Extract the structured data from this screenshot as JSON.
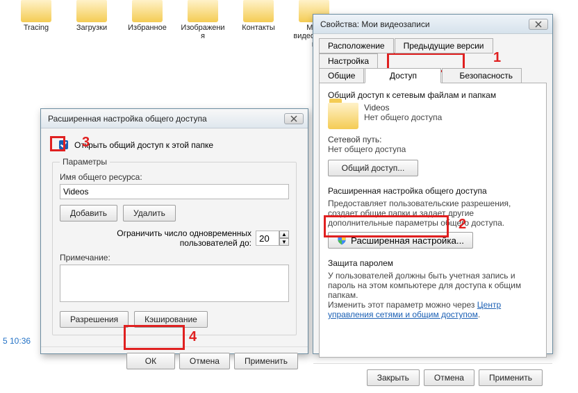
{
  "desktop": {
    "folders": [
      {
        "label": "Tracing"
      },
      {
        "label": "Загрузки"
      },
      {
        "label": "Избранное"
      },
      {
        "label": "Изображения"
      },
      {
        "label": "Контакты"
      },
      {
        "label": "Мои видеозаписи"
      }
    ],
    "timestamp": "5 10:36"
  },
  "adv": {
    "title": "Расширенная настройка общего доступа",
    "share_checkbox_label": "Открыть общий доступ к этой папке",
    "params_legend": "Параметры",
    "share_name_label": "Имя общего ресурса:",
    "share_name_value": "Videos",
    "add_btn": "Добавить",
    "remove_btn": "Удалить",
    "limit_label": "Ограничить число одновременных пользователей до:",
    "limit_value": "20",
    "note_label": "Примечание:",
    "perm_btn": "Разрешения",
    "cache_btn": "Кэширование",
    "ok_btn": "ОК",
    "cancel_btn": "Отмена",
    "apply_btn": "Применить"
  },
  "props": {
    "title": "Свойства: Мои видеозаписи",
    "tabs": {
      "location": "Расположение",
      "prev": "Предыдущие версии",
      "custom": "Настройка",
      "general": "Общие",
      "access": "Доступ",
      "security": "Безопасность"
    },
    "net_section": "Общий доступ к сетевым файлам и папкам",
    "share_name": "Videos",
    "share_state": "Нет общего доступа",
    "net_path_label": "Сетевой путь:",
    "net_path_value": "Нет общего доступа",
    "share_btn": "Общий доступ...",
    "adv_section": "Расширенная настройка общего доступа",
    "adv_desc": "Предоставляет пользовательские разрешения, создает общие папки и задает другие дополнительные параметры общего доступа.",
    "adv_btn": "Расширенная настройка...",
    "pw_section": "Защита паролем",
    "pw_desc1": "У пользователей должны быть учетная запись и пароль на этом компьютере для доступа к общим папкам.",
    "pw_desc2": "Изменить этот параметр можно через ",
    "pw_link": "Центр управления сетями и общим доступом",
    "close_btn": "Закрыть",
    "cancel_btn": "Отмена",
    "apply_btn": "Применить"
  },
  "ann": {
    "n1": "1",
    "n2": "2",
    "n3": "3",
    "n4": "4"
  }
}
